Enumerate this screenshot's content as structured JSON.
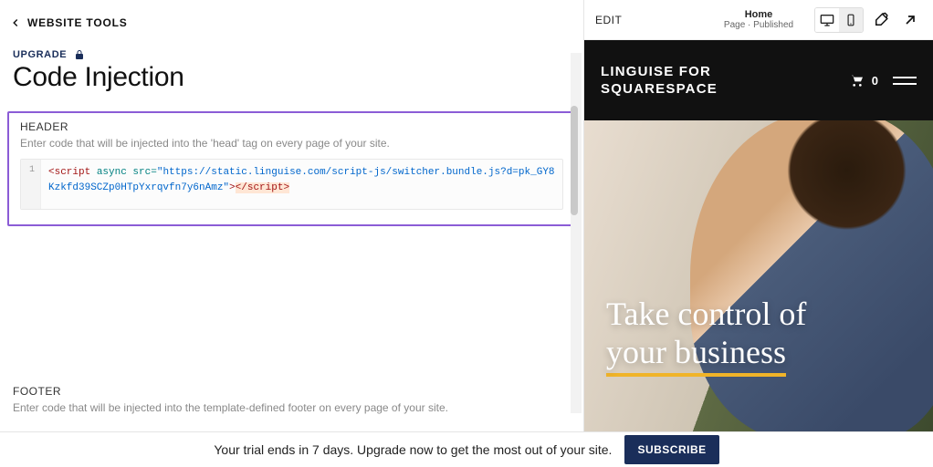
{
  "left": {
    "back_label": "WEBSITE TOOLS",
    "upgrade": "UPGRADE",
    "title": "Code Injection",
    "header": {
      "label": "HEADER",
      "desc": "Enter code that will be injected into the 'head' tag on every page of your site.",
      "line_no": "1",
      "code_open": "<script",
      "code_attrs": " async src=",
      "code_url": "\"https://static.linguise.com/script-js/switcher.bundle.js?d=pk_GY8Kzkfd39SCZp0HTpYxrqvfn7y6nAmz\"",
      "code_gt": ">",
      "code_close": "</script>"
    },
    "footer": {
      "label": "FOOTER",
      "desc": "Enter code that will be injected into the template-defined footer on every page of your site."
    }
  },
  "right": {
    "edit": "EDIT",
    "home": "Home",
    "sub": "Page · Published",
    "site_title_l1": "LINGUISE FOR",
    "site_title_l2": "SQUARESPACE",
    "cart_count": "0",
    "hero_l1": "Take control of",
    "hero_l2": "your business"
  },
  "banner": {
    "text": "Your trial ends in 7 days. Upgrade now to get the most out of your site.",
    "button": "SUBSCRIBE"
  }
}
